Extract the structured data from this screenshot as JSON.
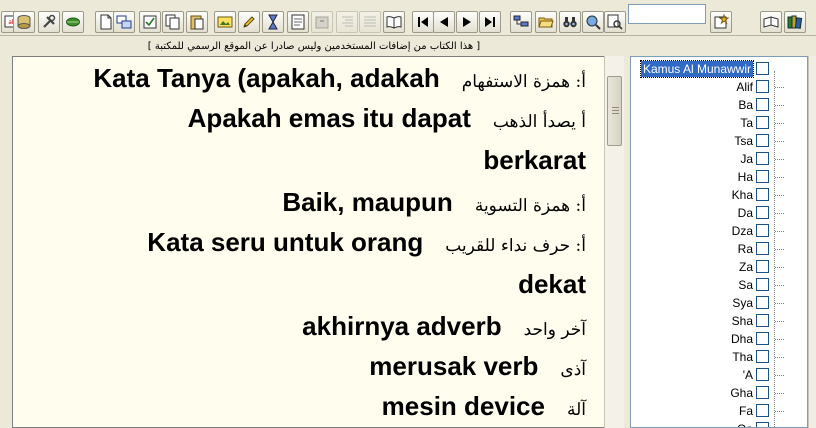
{
  "toolbar": {
    "search_value": "",
    "icons": [
      "options-icon",
      "database-icon",
      "tools-icon",
      "leaf-icon",
      "new-document-icon",
      "windows-icon",
      "checklist-icon",
      "copy-icon",
      "paste-icon",
      "image-icon",
      "pencil-icon",
      "hourglass-icon",
      "form-icon",
      "archive-icon",
      "align-right-icon",
      "align-justify-icon",
      "book-icon",
      "first-icon",
      "previous-icon",
      "next-icon",
      "last-icon",
      "tree-icon",
      "open-folder-icon",
      "binoculars-icon",
      "search-globe-icon",
      "find-next-icon",
      "add-book-icon",
      "open-book-icon",
      "bookshelf-icon"
    ]
  },
  "notice": "[ هذا الكتاب من إضافات المستخدمين وليس صادرا عن الموقع الرسمي للمكتبة ]",
  "content": {
    "entries": [
      {
        "arabic": "أ: همزة الاستفهام",
        "meaning": "Kata Tanya (apakah, adakah",
        "continuation": ""
      },
      {
        "arabic": "أ يصدأ الذهب",
        "meaning": "Apakah emas itu dapat",
        "continuation": "berkarat"
      },
      {
        "arabic": "أ: همزة التسوية",
        "meaning": "Baik, maupun",
        "continuation": ""
      },
      {
        "arabic": "أ: حرف نداء للقريب",
        "meaning": "Kata seru untuk orang",
        "continuation": "dekat"
      },
      {
        "arabic": "آخر واحد",
        "meaning": "akhirnya adverb",
        "continuation": ""
      },
      {
        "arabic": "آذى",
        "meaning": "merusak verb",
        "continuation": ""
      },
      {
        "arabic": "آلة",
        "meaning": "mesin device",
        "continuation": ""
      }
    ]
  },
  "sidebar": {
    "items": [
      {
        "label": "Kamus Al Munawwir",
        "selected": true
      },
      {
        "label": "Alif"
      },
      {
        "label": "Ba"
      },
      {
        "label": "Ta"
      },
      {
        "label": "Tsa"
      },
      {
        "label": "Ja"
      },
      {
        "label": "Ha"
      },
      {
        "label": "Kha"
      },
      {
        "label": "Da"
      },
      {
        "label": "Dza"
      },
      {
        "label": "Ra"
      },
      {
        "label": "Za"
      },
      {
        "label": "Sa"
      },
      {
        "label": "Sya"
      },
      {
        "label": "Sha"
      },
      {
        "label": "Dha"
      },
      {
        "label": "Tha"
      },
      {
        "label": "'A"
      },
      {
        "label": "Gha"
      },
      {
        "label": "Fa"
      },
      {
        "label": "Qa"
      }
    ]
  }
}
